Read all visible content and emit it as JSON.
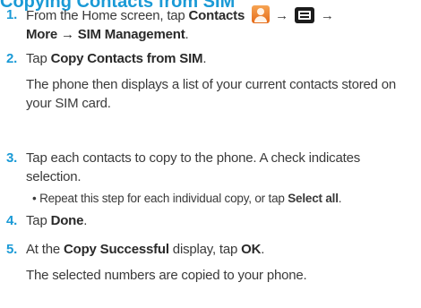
{
  "heading_fragment": "Copying Contacts from SIM",
  "steps": [
    {
      "num": "1.",
      "pre": "From the Home screen, tap ",
      "contacts_label": "Contacts",
      "arrow": "→",
      "line2": "More → SIM Management",
      "end": "."
    },
    {
      "num": "2.",
      "pre": "Tap ",
      "action": "Copy Contacts from SIM",
      "end": ".",
      "detail": "The phone then displays a list of your current contacts stored on your SIM card."
    },
    {
      "num": "3.",
      "text": "Tap each contacts to copy to the phone. A check indicates selection.",
      "bullet_pre": "• Repeat this step for each individual copy, or tap ",
      "bullet_bold": "Select all",
      "bullet_end": "."
    },
    {
      "num": "4.",
      "pre": "Tap ",
      "action": "Done",
      "end": "."
    },
    {
      "num": "5.",
      "pre": "At the ",
      "action": "Copy Successful",
      "mid": " display, tap ",
      "action2": "OK",
      "end": ".",
      "detail": "The selected numbers are copied to your phone."
    }
  ],
  "icons": {
    "contacts": "contacts-app-icon",
    "menu": "menu-key-icon"
  },
  "colors": {
    "accent": "#1a9ad6",
    "text": "#3a3a3a"
  }
}
